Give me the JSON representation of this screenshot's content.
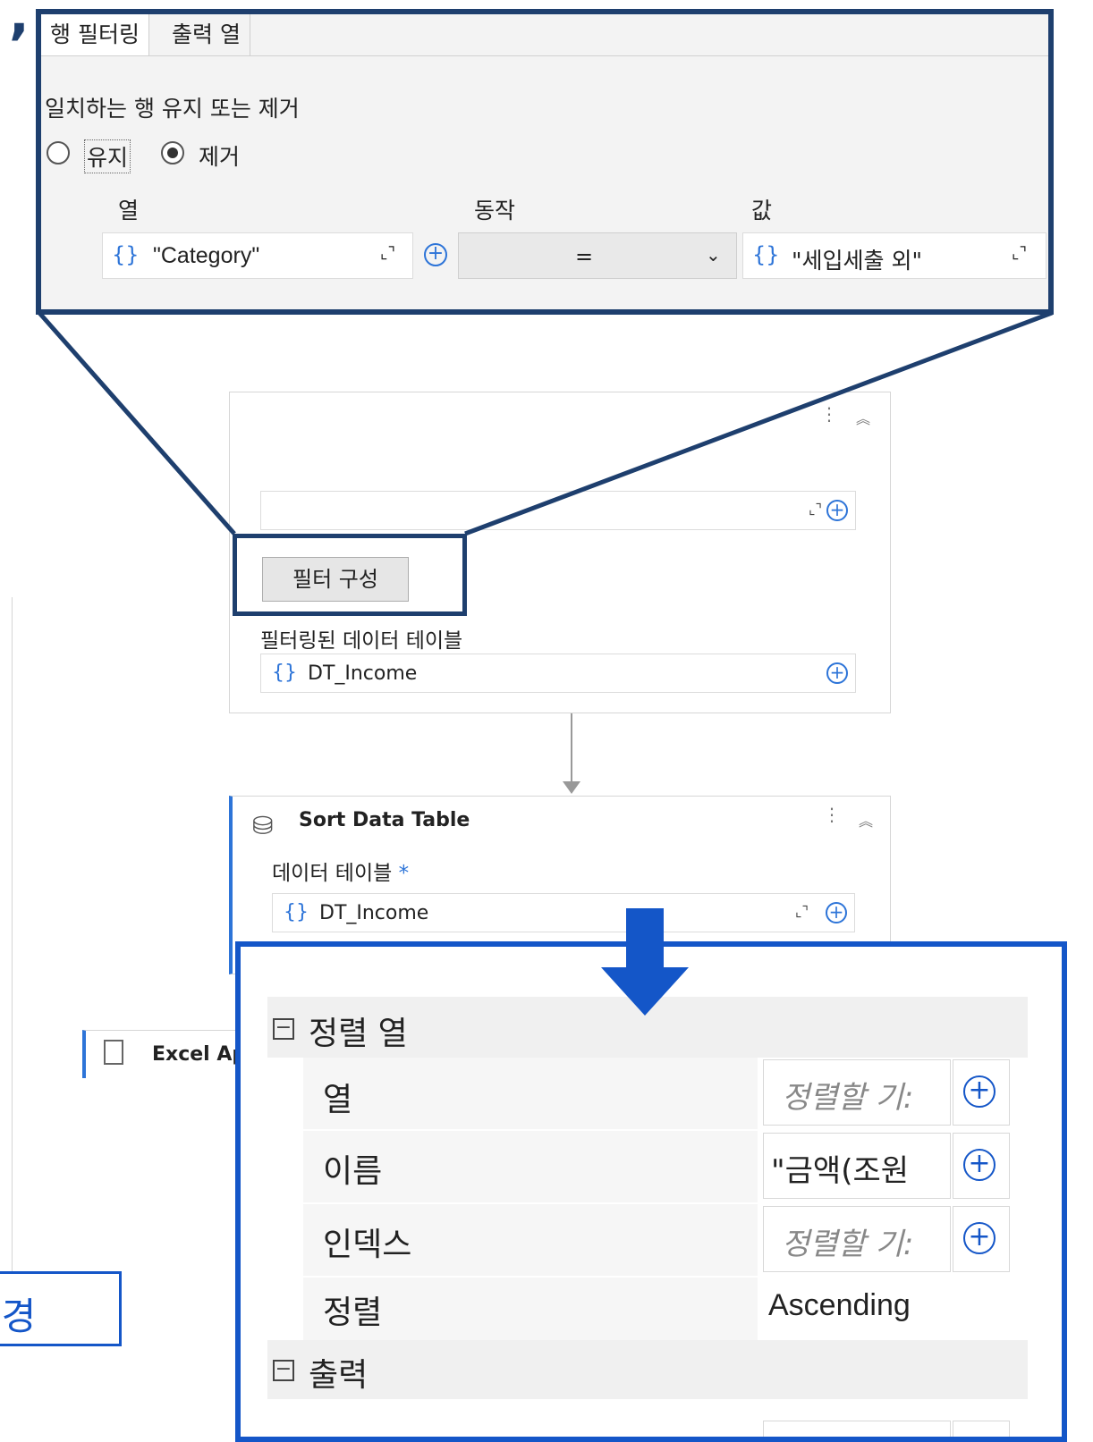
{
  "top_fragment": ",",
  "filter_panel": {
    "tabs": [
      "행 필터링",
      "출력 열"
    ],
    "mode_label": "일치하는 행 유지 또는 제거",
    "radio_keep": "유지",
    "radio_remove": "제거",
    "columns_header": {
      "col": "열",
      "op": "동작",
      "val": "값"
    },
    "row": {
      "column_value": "\"Category\"",
      "operator": "=",
      "value": "\"세입세출 외\""
    }
  },
  "filter_card": {
    "configure_button": "필터 구성",
    "output_label": "필터링된 데이터 테이블",
    "output_value": "DT_Income"
  },
  "sort_card": {
    "title": "Sort Data Table",
    "datatable_label": "데이터 테이블",
    "required_mark": "*",
    "datatable_value": "DT_Income"
  },
  "excel_card": {
    "title": "Excel Appl"
  },
  "left_box_text": "변경",
  "sort_properties": {
    "section_sort": "정렬 열",
    "rows": [
      {
        "label": "열",
        "value": "정렬할 기:",
        "placeholder": true
      },
      {
        "label": "이름",
        "value": "\"금액(조원",
        "placeholder": false
      },
      {
        "label": "인덱스",
        "value": "정렬할 기:",
        "placeholder": true
      },
      {
        "label": "정렬",
        "value": "Ascending",
        "placeholder": false
      }
    ],
    "section_output": "출력"
  },
  "colors": {
    "callout_top_border": "#1e3f6e",
    "callout_bottom_border": "#1456c8",
    "arrow": "#1456c8",
    "accent": "#2d74d8"
  }
}
